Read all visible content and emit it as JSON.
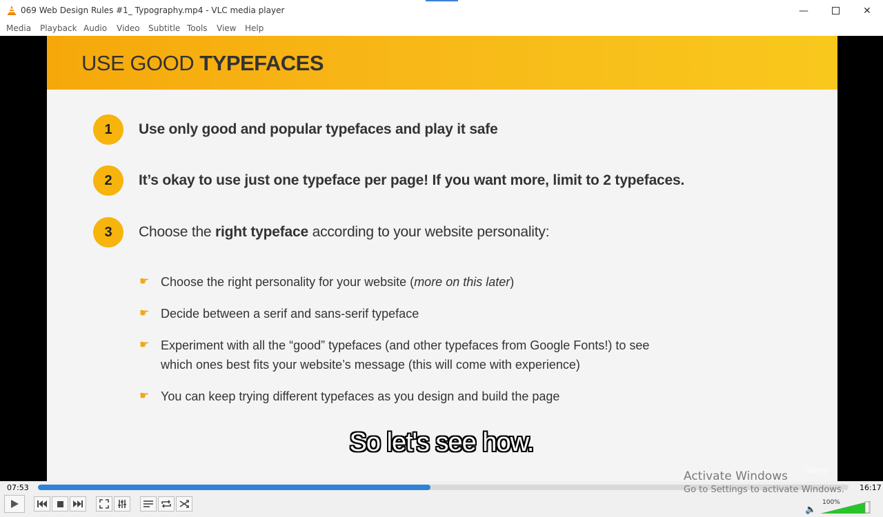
{
  "window": {
    "title": "069 Web Design Rules #1_ Typography.mp4 - VLC media player"
  },
  "menu": [
    "Media",
    "Playback",
    "Audio",
    "Video",
    "Subtitle",
    "Tools",
    "View",
    "Help"
  ],
  "slide": {
    "title_light": "USE GOOD ",
    "title_bold": "TYPEFACES",
    "points": [
      {
        "num": "1",
        "text": "Use only good and popular typefaces and play it safe"
      },
      {
        "num": "2",
        "text": "It’s okay to use just one typeface per page! If you want more, limit to 2 typefaces."
      },
      {
        "num": "3",
        "pre": "Choose the ",
        "bold": "right typeface",
        "post": " according to your website personality:"
      }
    ],
    "subpoints": {
      "s1_pre": "Choose the right personality for your website (",
      "s1_italic": "more on this later",
      "s1_post": ")",
      "s2": "Decide between a serif and sans-serif typeface",
      "s3_line1": "Experiment with all the “good” typefaces (and other typefaces from Google Fonts!) to see",
      "s3_line2": "which ones best fits your website’s message (this will come with experience)",
      "s4": "You can keep trying different typefaces as you design and build the page"
    },
    "watermark": "ûdemy"
  },
  "caption": "So let's see how.",
  "activation": {
    "line1": "Activate Windows",
    "line2": "Go to Settings to activate Windows."
  },
  "player": {
    "elapsed": "07:53",
    "total": "16:17",
    "progress_fraction": 0.484,
    "volume": "100%",
    "volume_fraction": 1.0,
    "accent_color": "#2f82d6",
    "volume_color": "#27c42b"
  }
}
